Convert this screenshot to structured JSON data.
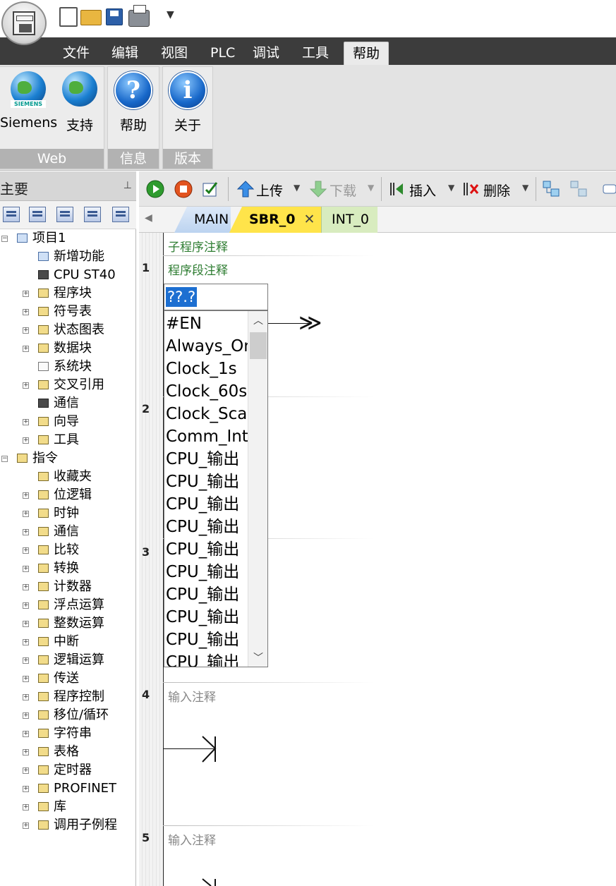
{
  "quick_access": {
    "dropdown_glyph": "▼"
  },
  "menu": {
    "tabs": [
      "文件",
      "编辑",
      "视图",
      "PLC",
      "调试",
      "工具",
      "帮助"
    ],
    "active_tab": "帮助"
  },
  "ribbon": {
    "groups": [
      {
        "label": "Web",
        "buttons": [
          "Siemens",
          "支持"
        ]
      },
      {
        "label": "信息",
        "buttons": [
          "帮助"
        ]
      },
      {
        "label": "版本",
        "buttons": [
          "关于"
        ]
      }
    ],
    "siemens_logo_text": "SIEMENS",
    "help_glyph": "?",
    "about_glyph": "i"
  },
  "left_panel": {
    "title": "主要",
    "pin_glyph": "⊥",
    "tree": [
      {
        "label": "项目1",
        "level": 0,
        "expander": "-",
        "icon": "project-icon"
      },
      {
        "label": "新增功能",
        "level": 1,
        "expander": "",
        "icon": "whats-new-icon"
      },
      {
        "label": "CPU ST40",
        "level": 1,
        "expander": "",
        "icon": "cpu-icon"
      },
      {
        "label": "程序块",
        "level": 1,
        "expander": "+",
        "icon": "program-block-icon"
      },
      {
        "label": "符号表",
        "level": 1,
        "expander": "+",
        "icon": "symbol-table-icon"
      },
      {
        "label": "状态图表",
        "level": 1,
        "expander": "+",
        "icon": "status-chart-icon"
      },
      {
        "label": "数据块",
        "level": 1,
        "expander": "+",
        "icon": "data-block-icon"
      },
      {
        "label": "系统块",
        "level": 1,
        "expander": "",
        "icon": "system-block-icon"
      },
      {
        "label": "交叉引用",
        "level": 1,
        "expander": "+",
        "icon": "cross-reference-icon"
      },
      {
        "label": "通信",
        "level": 1,
        "expander": "",
        "icon": "communication-icon"
      },
      {
        "label": "向导",
        "level": 1,
        "expander": "+",
        "icon": "wizard-icon"
      },
      {
        "label": "工具",
        "level": 1,
        "expander": "+",
        "icon": "tools-icon"
      },
      {
        "label": "指令",
        "level": 0,
        "expander": "-",
        "icon": "instructions-icon"
      },
      {
        "label": "收藏夹",
        "level": 1,
        "expander": "",
        "icon": "favorites-icon"
      },
      {
        "label": "位逻辑",
        "level": 1,
        "expander": "+",
        "icon": "bit-logic-icon"
      },
      {
        "label": "时钟",
        "level": 1,
        "expander": "+",
        "icon": "clock-icon"
      },
      {
        "label": "通信",
        "level": 1,
        "expander": "+",
        "icon": "comm-instr-icon"
      },
      {
        "label": "比较",
        "level": 1,
        "expander": "+",
        "icon": "compare-icon"
      },
      {
        "label": "转换",
        "level": 1,
        "expander": "+",
        "icon": "convert-icon"
      },
      {
        "label": "计数器",
        "level": 1,
        "expander": "+",
        "icon": "counter-icon"
      },
      {
        "label": "浮点运算",
        "level": 1,
        "expander": "+",
        "icon": "float-math-icon"
      },
      {
        "label": "整数运算",
        "level": 1,
        "expander": "+",
        "icon": "int-math-icon"
      },
      {
        "label": "中断",
        "level": 1,
        "expander": "+",
        "icon": "interrupt-icon"
      },
      {
        "label": "逻辑运算",
        "level": 1,
        "expander": "+",
        "icon": "logic-op-icon"
      },
      {
        "label": "传送",
        "level": 1,
        "expander": "+",
        "icon": "move-icon"
      },
      {
        "label": "程序控制",
        "level": 1,
        "expander": "+",
        "icon": "program-control-icon"
      },
      {
        "label": "移位/循环",
        "level": 1,
        "expander": "+",
        "icon": "shift-rotate-icon"
      },
      {
        "label": "字符串",
        "level": 1,
        "expander": "+",
        "icon": "string-icon"
      },
      {
        "label": "表格",
        "level": 1,
        "expander": "+",
        "icon": "table-icon"
      },
      {
        "label": "定时器",
        "level": 1,
        "expander": "+",
        "icon": "timer-icon"
      },
      {
        "label": "PROFINET",
        "level": 1,
        "expander": "+",
        "icon": "profinet-icon"
      },
      {
        "label": "库",
        "level": 1,
        "expander": "+",
        "icon": "library-icon"
      },
      {
        "label": "调用子例程",
        "level": 1,
        "expander": "+",
        "icon": "call-subroutine-icon"
      }
    ]
  },
  "editor_toolbar": {
    "upload": "上传",
    "download": "下载",
    "insert": "插入",
    "delete": "删除"
  },
  "program_tabs": [
    {
      "label": "MAIN",
      "active": false
    },
    {
      "label": "SBR_0",
      "active": true,
      "close_glyph": "✕"
    },
    {
      "label": "INT_0",
      "active": false
    }
  ],
  "editor": {
    "subroutine_comment": "子程序注释",
    "networks": [
      {
        "number": "1",
        "comment": "程序段注释"
      },
      {
        "number": "2",
        "comment": ""
      },
      {
        "number": "3",
        "comment": ""
      },
      {
        "number": "4",
        "comment": "输入注释"
      },
      {
        "number": "5",
        "comment": "输入注释"
      }
    ],
    "address_input": "??.?",
    "autocomplete": [
      "#EN",
      "Always_On",
      "Clock_1s",
      "Clock_60s",
      "Clock_Scan",
      "Comm_Int",
      "CPU_输出",
      "CPU_输出",
      "CPU_输出",
      "CPU_输出",
      "CPU_输出",
      "CPU_输出",
      "CPU_输出",
      "CPU_输出",
      "CPU_输出",
      "CPU_输出"
    ]
  }
}
